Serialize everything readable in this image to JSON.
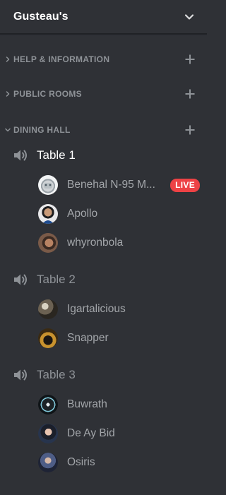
{
  "server": {
    "name": "Gusteau's"
  },
  "categories": [
    {
      "label": "HELP & INFORMATION",
      "expanded": false
    },
    {
      "label": "PUBLIC ROOMS",
      "expanded": false
    },
    {
      "label": "DINING HALL",
      "expanded": true
    }
  ],
  "channels": [
    {
      "name": "Table 1",
      "active": true,
      "users": [
        {
          "name": "Benehal N-95 M...",
          "badge": "LIVE"
        },
        {
          "name": "Apollo"
        },
        {
          "name": "whyronbola"
        }
      ]
    },
    {
      "name": "Table 2",
      "active": false,
      "users": [
        {
          "name": "Igartalicious"
        },
        {
          "name": "Snapper"
        }
      ]
    },
    {
      "name": "Table 3",
      "active": false,
      "users": [
        {
          "name": "Buwrath"
        },
        {
          "name": "De Ay Bid"
        },
        {
          "name": "Osiris"
        }
      ]
    }
  ],
  "colors": {
    "background": "#2f3136",
    "live_badge": "#ed4245",
    "text_muted": "#8e9297",
    "text_active": "#ffffff"
  }
}
